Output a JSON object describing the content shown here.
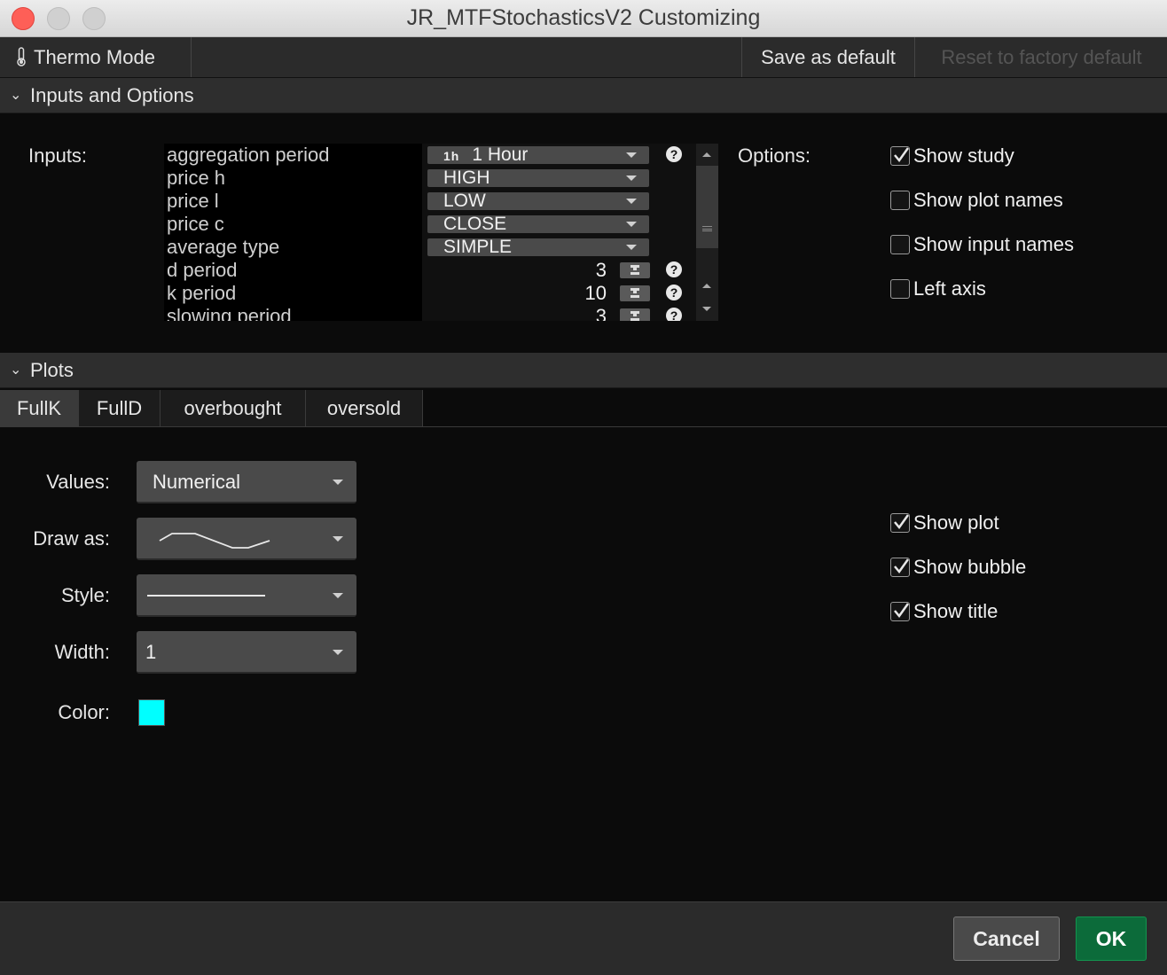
{
  "window": {
    "title": "JR_MTFStochasticsV2 Customizing"
  },
  "toolbar": {
    "thermo_mode": "Thermo Mode",
    "save_default": "Save as default",
    "reset_default": "Reset to factory default"
  },
  "inputs_section": {
    "header": "Inputs and Options",
    "inputs_label": "Inputs:",
    "options_label": "Options:",
    "rows": [
      {
        "name": "aggregation period",
        "type": "dropdown",
        "badge": "1h",
        "value": "1 Hour",
        "help": true
      },
      {
        "name": "price h",
        "type": "dropdown",
        "value": "HIGH"
      },
      {
        "name": "price l",
        "type": "dropdown",
        "value": "LOW"
      },
      {
        "name": "price c",
        "type": "dropdown",
        "value": "CLOSE"
      },
      {
        "name": "average type",
        "type": "dropdown",
        "value": "SIMPLE"
      },
      {
        "name": "d period",
        "type": "number",
        "value": "3",
        "help": true
      },
      {
        "name": "k period",
        "type": "number",
        "value": "10",
        "help": true
      },
      {
        "name": "slowing period",
        "type": "number",
        "value": "3",
        "help": true
      }
    ],
    "options": [
      {
        "label": "Show study",
        "checked": true
      },
      {
        "label": "Show plot names",
        "checked": false
      },
      {
        "label": "Show input names",
        "checked": false
      },
      {
        "label": "Left axis",
        "checked": false
      }
    ]
  },
  "plots_section": {
    "header": "Plots",
    "tabs": [
      "FullK",
      "FullD",
      "overbought",
      "oversold"
    ],
    "active_tab": "FullK",
    "values_label": "Values:",
    "values_value": "Numerical",
    "draw_as_label": "Draw as:",
    "style_label": "Style:",
    "width_label": "Width:",
    "width_value": "1",
    "color_label": "Color:",
    "color_value": "#00ffff",
    "checks": [
      {
        "label": "Show plot",
        "checked": true
      },
      {
        "label": "Show bubble",
        "checked": true
      },
      {
        "label": "Show title",
        "checked": true
      }
    ]
  },
  "footer": {
    "cancel": "Cancel",
    "ok": "OK"
  },
  "colors": {
    "ok_button": "#0c6b3a",
    "close_light": "#fe5f57",
    "plot_color": "#00ffff"
  }
}
